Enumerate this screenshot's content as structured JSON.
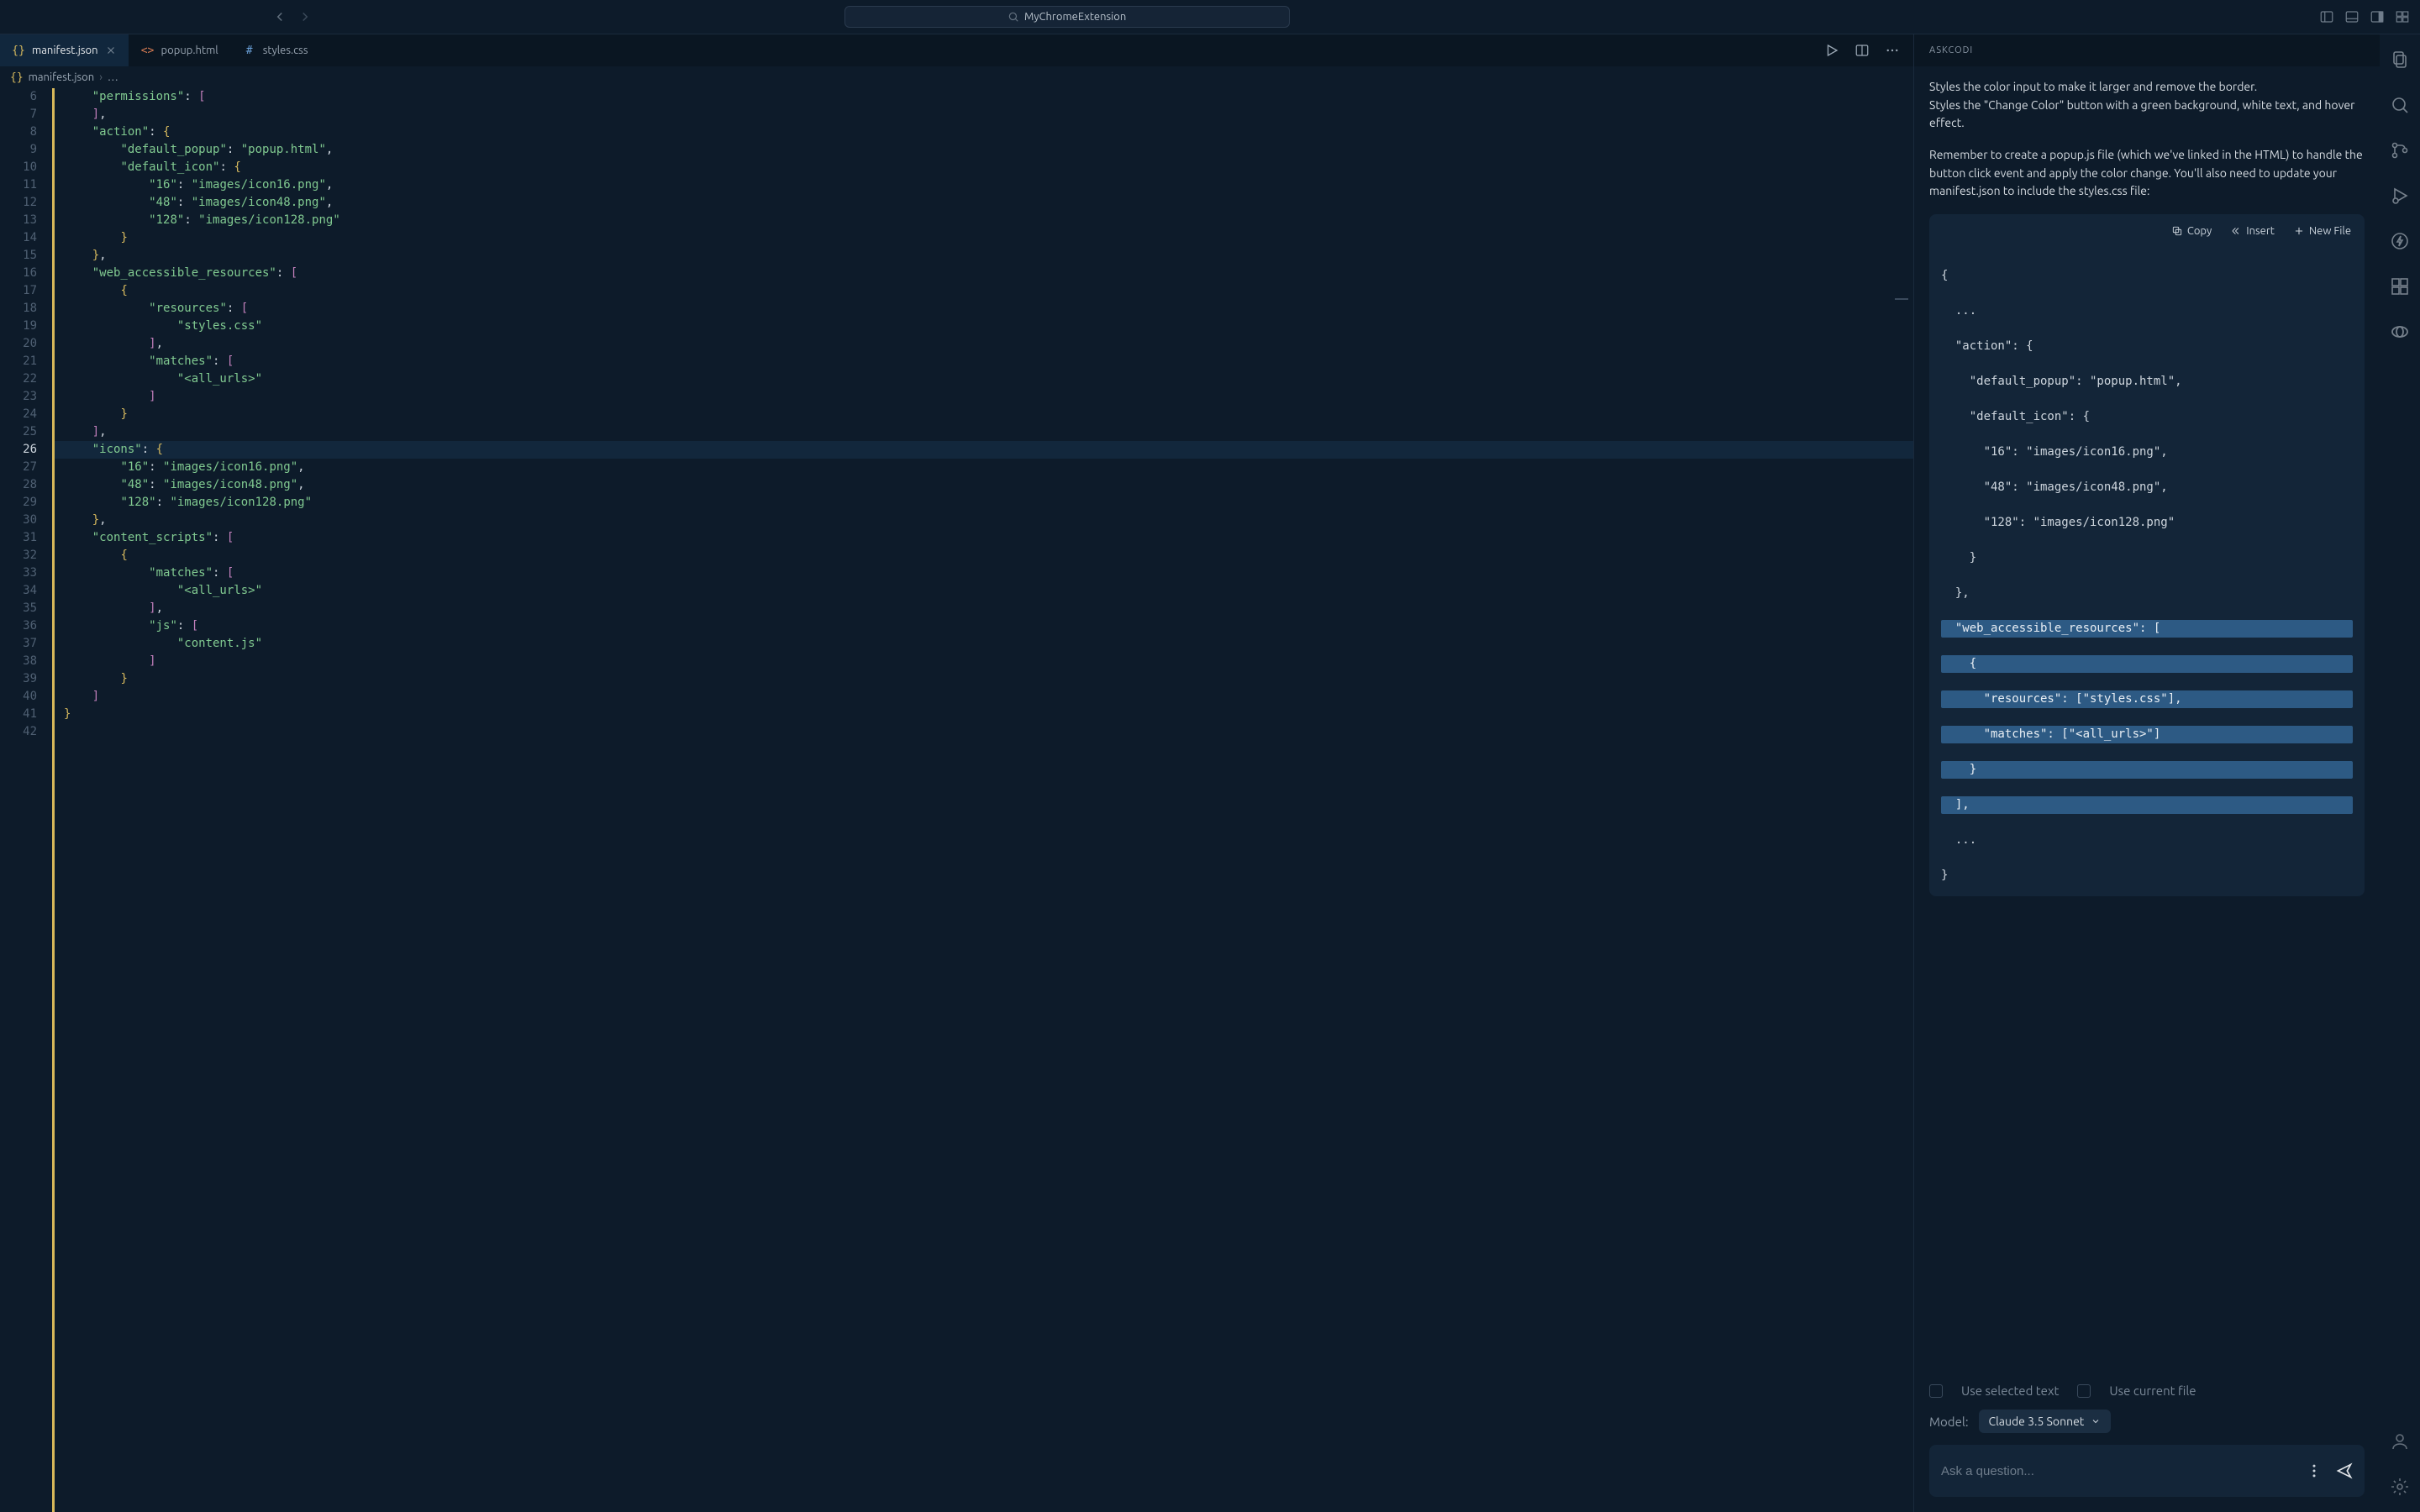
{
  "title": "MyChromeExtension",
  "tabs": [
    {
      "label": "manifest.json",
      "icon": "{}",
      "active": true,
      "dirty": false
    },
    {
      "label": "popup.html",
      "icon": "<>",
      "active": false
    },
    {
      "label": "styles.css",
      "icon": "#",
      "active": false
    }
  ],
  "breadcrumb": {
    "icon": "{}",
    "file": "manifest.json",
    "trail": "…"
  },
  "gutter_start": 6,
  "gutter_end": 42,
  "gutter_current": 26,
  "panel": {
    "title": "ASKCODI",
    "para1": "Styles the color input to make it larger and remove the border.\nStyles the \"Change Color\" button with a green background, white text, and hover effect.",
    "para2": "Remember to create a popup.js file (which we've linked in the HTML) to handle the button click event and apply the color change. You'll also need to update your manifest.json to include the styles.css file:",
    "toolbar": {
      "copy": "Copy",
      "insert": "Insert",
      "newfile": "New File"
    },
    "check1": "Use selected text",
    "check2": "Use current file",
    "model_label": "Model:",
    "model_value": "Claude 3.5 Sonnet",
    "ask_placeholder": "Ask a question..."
  },
  "snippet": {
    "l1": "{",
    "l2": "  ...",
    "l3": "  \"action\": {",
    "l4": "    \"default_popup\": \"popup.html\",",
    "l5": "    \"default_icon\": {",
    "l6": "      \"16\": \"images/icon16.png\",",
    "l7": "      \"48\": \"images/icon48.png\",",
    "l8": "      \"128\": \"images/icon128.png\"",
    "l9": "    }",
    "l10": "  },",
    "h1": "  \"web_accessible_resources\": [",
    "h2": "    {",
    "h3": "      \"resources\": [\"styles.css\"],",
    "h4": "      \"matches\": [\"<all_urls>\"]",
    "h5": "    }",
    "h6": "  ],",
    "l11": "  ...",
    "l12": "}"
  }
}
